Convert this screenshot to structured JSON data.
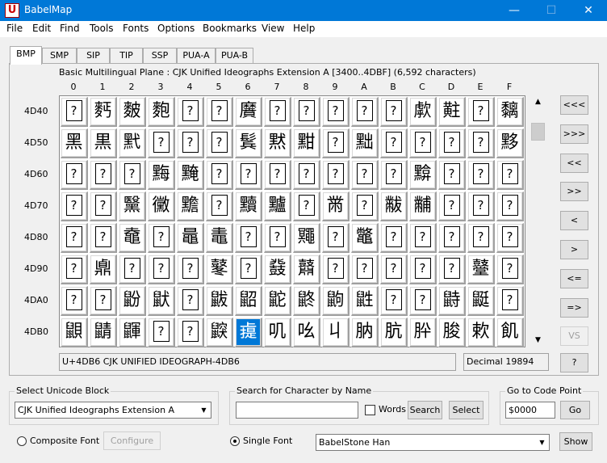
{
  "window": {
    "title": "BabelMap",
    "icon_letter": "U",
    "min": "—",
    "max": "☐",
    "close": "✕"
  },
  "menu": [
    "File",
    "Edit",
    "Find",
    "Tools",
    "Fonts",
    "Options",
    "Bookmarks",
    "View",
    "Help"
  ],
  "tabs": [
    "BMP",
    "SMP",
    "SIP",
    "TIP",
    "SSP",
    "PUA-A",
    "PUA-B"
  ],
  "active_tab": "BMP",
  "block_caption": "Basic Multilingual Plane : CJK Unified Ideographs Extension A [3400..4DBF] (6,592 characters)",
  "columns": [
    "0",
    "1",
    "2",
    "3",
    "4",
    "5",
    "6",
    "7",
    "8",
    "9",
    "A",
    "B",
    "C",
    "D",
    "E",
    "F"
  ],
  "rows": [
    {
      "label": "4D40",
      "cells": [
        "?",
        "麫",
        "麬",
        "麭",
        "?",
        "?",
        "黂",
        "?",
        "?",
        "?",
        "?",
        "?",
        "歑",
        "黈",
        "?",
        "黐"
      ]
    },
    {
      "label": "4D50",
      "cells": [
        "黑",
        "黒",
        "黓",
        "?",
        "?",
        "?",
        "鬂",
        "黙",
        "黚",
        "?",
        "黜",
        "?",
        "?",
        "?",
        "?",
        "黟"
      ]
    },
    {
      "label": "4D60",
      "cells": [
        "?",
        "?",
        "?",
        "黣",
        "黤",
        "?",
        "?",
        "?",
        "?",
        "?",
        "?",
        "?",
        "黭",
        "?",
        "?",
        "?"
      ]
    },
    {
      "label": "4D70",
      "cells": [
        "?",
        "?",
        "黳",
        "黴",
        "黵",
        "?",
        "黷",
        "黸",
        "?",
        "黹",
        "?",
        "黻",
        "黼",
        "?",
        "?",
        "?"
      ]
    },
    {
      "label": "4D80",
      "cells": [
        "?",
        "?",
        "鼀",
        "?",
        "鼂",
        "鼃",
        "?",
        "?",
        "鼆",
        "?",
        "鼈",
        "?",
        "?",
        "?",
        "?",
        "?"
      ]
    },
    {
      "label": "4D90",
      "cells": [
        "?",
        "鼑",
        "?",
        "?",
        "?",
        "鼕",
        "?",
        "鼗",
        "鼘",
        "?",
        "?",
        "?",
        "?",
        "?",
        "鼞",
        "?"
      ]
    },
    {
      "label": "4DA0",
      "cells": [
        "?",
        "?",
        "鼢",
        "鼣",
        "?",
        "鼥",
        "鼦",
        "鼧",
        "鼨",
        "鼩",
        "鼪",
        "?",
        "?",
        "鼭",
        "鼮",
        "?"
      ]
    },
    {
      "label": "4DB0",
      "cells": [
        "鼰",
        "鼱",
        "鼲",
        "?",
        "?",
        "鼵",
        "䶶",
        "叽",
        "吆",
        "丩",
        "肭",
        "肮",
        "肸",
        "朘",
        "欶",
        "飢"
      ]
    }
  ],
  "selected": {
    "row": 7,
    "col": 6
  },
  "status": {
    "char_name": "U+4DB6 CJK UNIFIED IDEOGRAPH-4DB6",
    "decimal": "Decimal 19894"
  },
  "nav_buttons": [
    "<<<",
    ">>>",
    "<<",
    ">>",
    "<",
    ">",
    "<=",
    "=>",
    "VS",
    "?"
  ],
  "scroll": {
    "up": "▲",
    "down": "▼"
  },
  "select_block": {
    "label": "Select Unicode Block",
    "value": "CJK Unified Ideographs Extension A"
  },
  "search": {
    "label": "Search for Character by Name",
    "value": "",
    "words_label": "Words",
    "search_button": "Search",
    "select_button": "Select"
  },
  "goto": {
    "label": "Go to Code Point",
    "value": "$0000",
    "button": "Go"
  },
  "font_mode": {
    "composite_label": "Composite Font",
    "configure_button": "Configure",
    "single_label": "Single Font",
    "font_value": "BabelStone Han",
    "show_button": "Show"
  },
  "dropdown_glyph": "▼"
}
